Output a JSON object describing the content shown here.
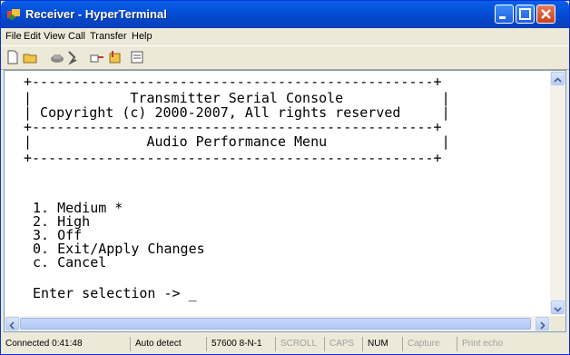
{
  "window": {
    "title": "Receiver - HyperTerminal",
    "icon": "hyperterminal-icon",
    "controls": [
      "minimize-icon",
      "maximize-icon",
      "close-icon"
    ]
  },
  "menu": [
    "File",
    "Edit",
    "View",
    "Call",
    "Transfer",
    "Help"
  ],
  "toolbar": [
    "new-icon",
    "open-icon",
    "call-icon",
    "disconnect-icon",
    "send-icon",
    "receive-icon",
    "properties-icon"
  ],
  "terminal": {
    "lines": [
      "+-------------------------------------------------+",
      "|            Transmitter Serial Console            |",
      "| Copyright (c) 2000-2007, All rights reserved     |",
      "+-------------------------------------------------+",
      "|              Audio Performance Menu              |",
      "+-------------------------------------------------+",
      "1. Medium *",
      "2. High",
      "3. Off",
      "0. Exit/Apply Changes",
      "c. Cancel",
      "Enter selection -> _"
    ]
  },
  "status": {
    "connected": "Connected 0:41:48",
    "detect": "Auto detect",
    "port": "57600 8-N-1",
    "scroll": "SCROLL",
    "caps": "CAPS",
    "num": "NUM",
    "capture": "Capture",
    "print": "Print echo"
  }
}
